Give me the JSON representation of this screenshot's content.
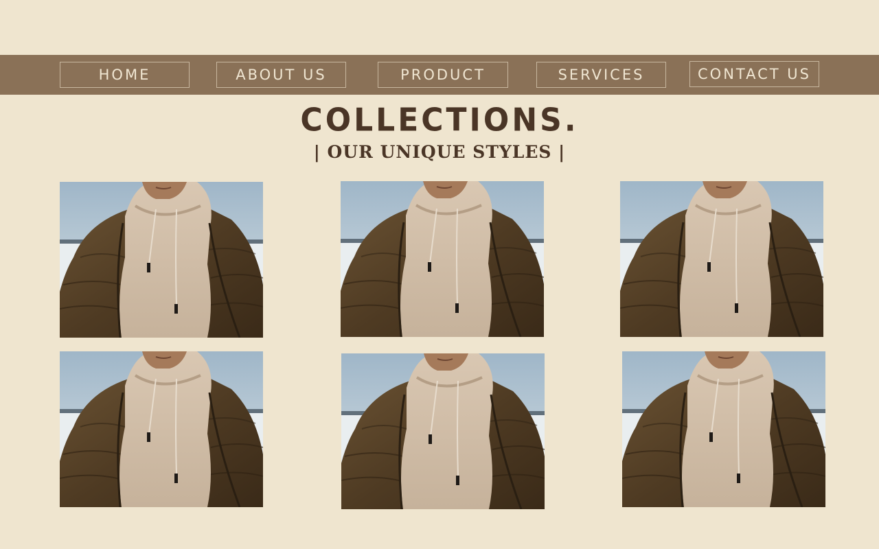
{
  "nav": {
    "items": [
      {
        "label": "HOME"
      },
      {
        "label": "ABOUT US"
      },
      {
        "label": "PRODUCT"
      },
      {
        "label": "SERVICES"
      },
      {
        "label": "CONTACT US"
      }
    ]
  },
  "header": {
    "title": "COLLECTIONS.",
    "subtitle": "| OUR UNIQUE STYLES |"
  },
  "gallery": {
    "items": [
      {
        "image": "hoodie-puffer-jacket-photo"
      },
      {
        "image": "hoodie-puffer-jacket-photo"
      },
      {
        "image": "hoodie-puffer-jacket-photo"
      },
      {
        "image": "hoodie-puffer-jacket-photo"
      },
      {
        "image": "hoodie-puffer-jacket-photo"
      },
      {
        "image": "hoodie-puffer-jacket-photo"
      }
    ]
  },
  "colors": {
    "background": "#efe5cf",
    "nav_bar": "#8a7157",
    "heading": "#4a3526"
  }
}
